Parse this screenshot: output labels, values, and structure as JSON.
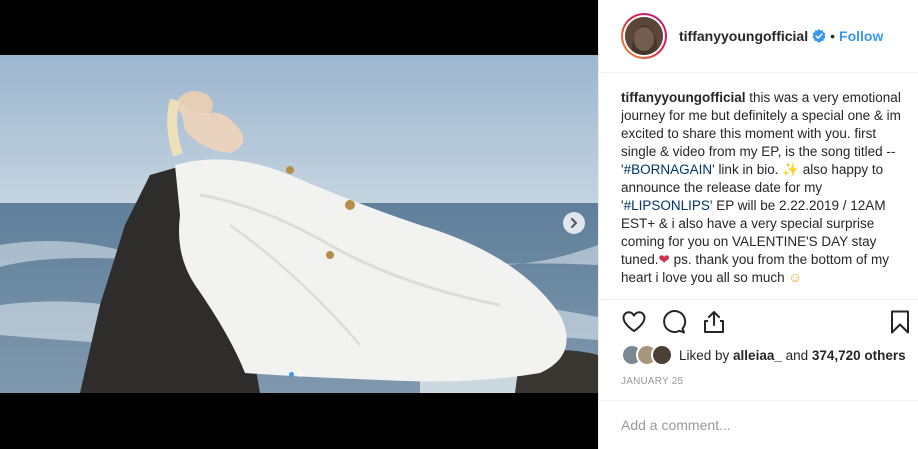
{
  "post": {
    "username": "tiffanyyoungofficial",
    "verified": true,
    "follow_separator": "•",
    "follow_label": "Follow"
  },
  "caption": {
    "username": "tiffanyyoungofficial",
    "text_1": " this was a very emotional journey for me but definitely a special one & im excited to share this moment with you. first single & video from my EP, is the song titled -- '",
    "hashtag_1": "#BORNAGAIN",
    "text_2": "' link in bio. ",
    "emoji_1": "✨",
    "text_3": " also happy to announce the release date for my '",
    "hashtag_2": "#LIPSONLIPS",
    "text_4": "' EP will be 2.22.2019 / 12AM EST+ & i also have a very special surprise coming for you on VALENTINE'S DAY stay tuned.",
    "emoji_2": "❤",
    "text_5": " ps. thank you from the bottom of my heart i love you all so much ",
    "emoji_3": "☺"
  },
  "likes": {
    "prefix": "Liked by ",
    "user": "alleiaa_",
    "conjunction": " and ",
    "count": "374,720 others"
  },
  "date": "JANUARY 25",
  "comment": {
    "placeholder": "Add a comment..."
  },
  "carousel": {
    "total_slides": 2,
    "active_slide": 1
  },
  "icons": {
    "like": "heart-icon",
    "comment": "comment-bubble-icon",
    "share": "share-icon",
    "save": "bookmark-icon",
    "verified": "verified-badge-icon",
    "next": "chevron-right-icon"
  },
  "colors": {
    "link": "#3897f0",
    "hashtag": "#003569",
    "muted": "#999999",
    "text": "#262626"
  }
}
